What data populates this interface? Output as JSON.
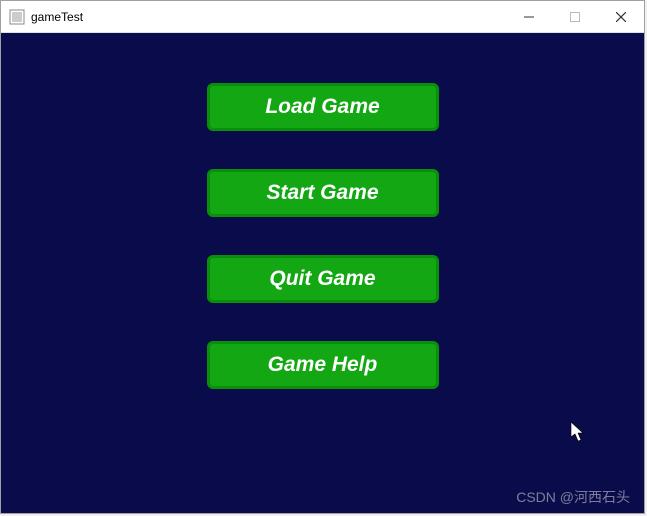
{
  "window": {
    "title": "gameTest"
  },
  "menu": {
    "buttons": [
      {
        "label": "Load Game"
      },
      {
        "label": "Start Game"
      },
      {
        "label": "Quit Game"
      },
      {
        "label": "Game Help"
      }
    ]
  },
  "watermark": "CSDN @河西石头",
  "colors": {
    "game_bg": "#0a0b4a",
    "button_bg": "#13a813",
    "button_border": "#0a8f0a",
    "button_text": "#ffffff"
  }
}
